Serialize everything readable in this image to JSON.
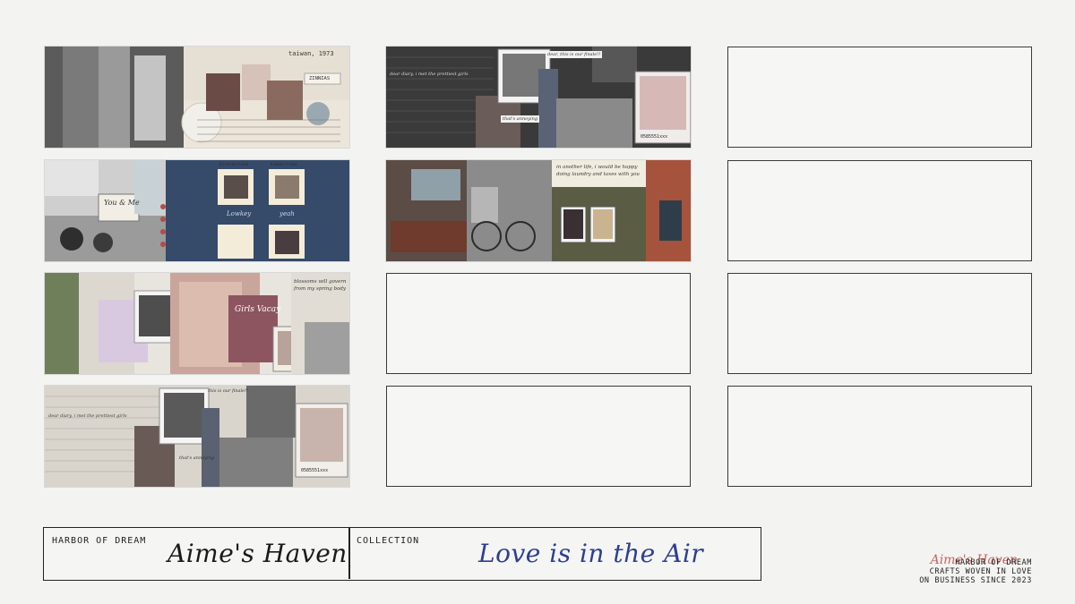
{
  "brand_label": "HARBOR OF DREAM",
  "brand_name": "Aime's Haven",
  "collection_label": "COLLECTION",
  "collection_name": "Love is in the Air",
  "tagline": [
    "HARBOR OF DREAM",
    "CRAFTS WOVEN IN LOVE",
    "ON BUSINESS SINCE 2023"
  ],
  "signature": "Aime's Haven",
  "colors": {
    "ink": "#222222",
    "collection_script": "#2d3f8f",
    "brand_script": "#1a1a1a",
    "signature": "#b3362f"
  },
  "columns": [
    {
      "name": "left",
      "items": [
        {
          "kind": "collage",
          "theme": "paper-letter",
          "texts": [
            "taiwan, 1973",
            "ZINNIAS"
          ]
        },
        {
          "kind": "collage",
          "theme": "navy-board",
          "texts": [
            "You & Me",
            "Lowkey",
            "yeah",
            "Distractions",
            "Kimbertrims"
          ]
        },
        {
          "kind": "collage",
          "theme": "sage-scrapbook",
          "texts": [
            "Girls Vacay",
            "blossoms will govern from my spring body"
          ]
        },
        {
          "kind": "collage",
          "theme": "lined-journal",
          "texts": [
            "dear diary, i met the prettiest girls",
            "this is our finale!!",
            "that's annoying",
            "0585551xxx"
          ]
        }
      ]
    },
    {
      "name": "middle",
      "items": [
        {
          "kind": "collage",
          "theme": "dark-journal",
          "texts": [
            "dear diary, i met the prettiest girls",
            "dear, this is our finale!!",
            "that's annoying",
            "0585551xxx"
          ]
        },
        {
          "kind": "collage",
          "theme": "room-window",
          "texts": [
            "in another life, i would be happy doing laundry and taxes with you"
          ]
        },
        {
          "kind": "empty"
        },
        {
          "kind": "empty"
        }
      ]
    },
    {
      "name": "right",
      "items": [
        {
          "kind": "empty"
        },
        {
          "kind": "empty"
        },
        {
          "kind": "empty"
        },
        {
          "kind": "empty"
        }
      ]
    }
  ]
}
